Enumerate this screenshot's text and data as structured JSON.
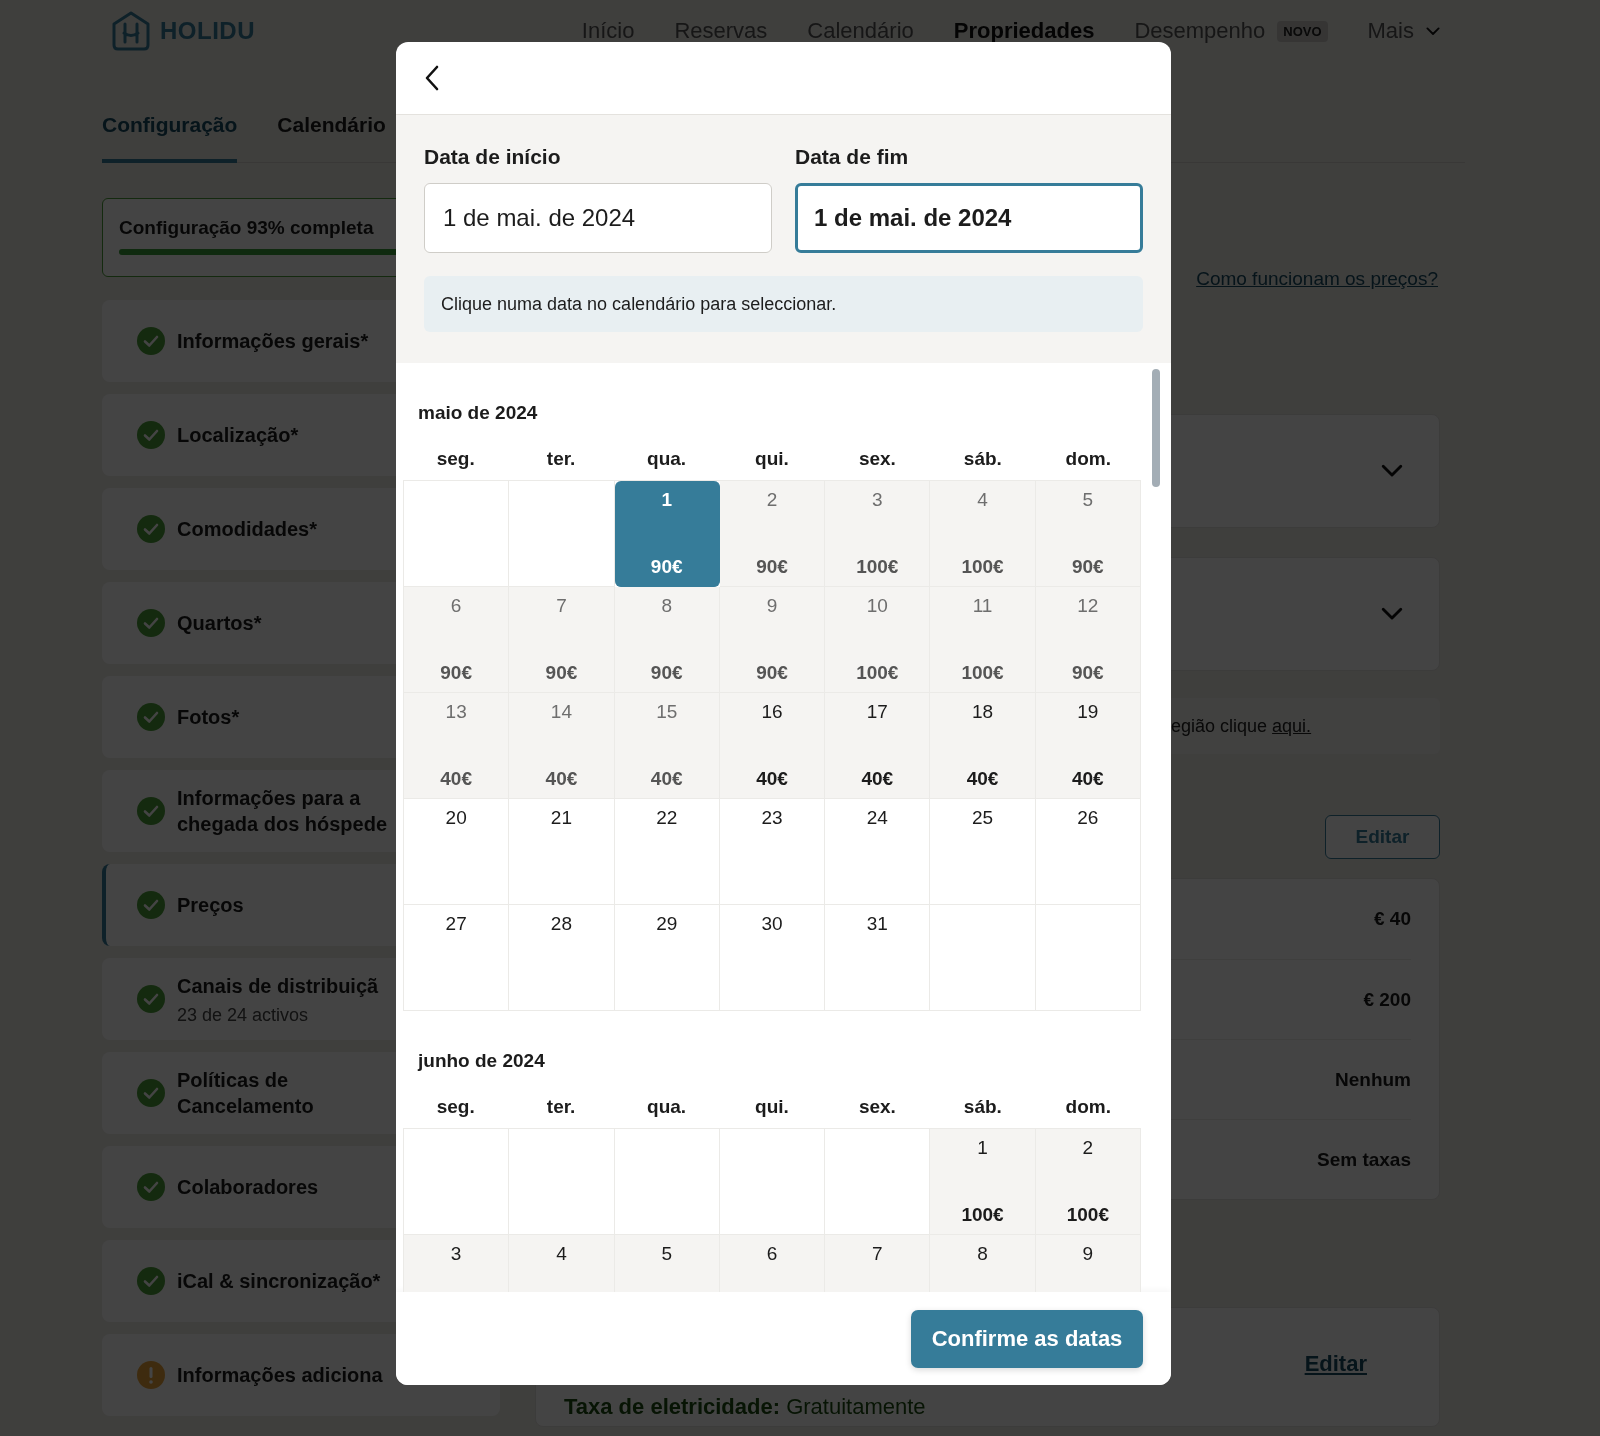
{
  "header": {
    "brand": "HOLIDU",
    "nav": [
      {
        "label": "Início",
        "selected": false
      },
      {
        "label": "Reservas",
        "selected": false
      },
      {
        "label": "Calendário",
        "selected": false
      },
      {
        "label": "Propriedades",
        "selected": true
      },
      {
        "label": "Desempenho",
        "selected": false,
        "badge": "NOVO"
      },
      {
        "label": "Mais",
        "selected": false,
        "dropdown": true
      }
    ]
  },
  "tabs": [
    {
      "label": "Configuração",
      "selected": true
    },
    {
      "label": "Calendário",
      "selected": false
    }
  ],
  "sidebar": {
    "progress": {
      "label": "Configuração 93% completa",
      "level": 0.93
    },
    "items": [
      {
        "title": "Informações gerais*",
        "complete": true,
        "selected": false
      },
      {
        "title": "Localização*",
        "complete": true,
        "selected": false
      },
      {
        "title": "Comodidades*",
        "complete": true,
        "selected": false
      },
      {
        "title": "Quartos*",
        "complete": true,
        "selected": false
      },
      {
        "title": "Fotos*",
        "complete": true,
        "selected": false
      },
      {
        "title": "Informações para a\nchegada dos hóspede",
        "complete": true,
        "selected": false
      },
      {
        "title": "Preços",
        "complete": true,
        "selected": true
      },
      {
        "title": "Canais de distribuiçã",
        "subtitle": "23 de 24 activos",
        "complete": true,
        "selected": false
      },
      {
        "title": "Políticas de\nCancelamento",
        "complete": true,
        "selected": false
      },
      {
        "title": "Colaboradores",
        "complete": true,
        "selected": false
      },
      {
        "title": "iCal & sincronização*",
        "complete": true,
        "selected": false
      },
      {
        "title": "Informações adiciona",
        "complete": false,
        "selected": false
      }
    ]
  },
  "main": {
    "help_link": "Como funcionam os preços?",
    "accordions": [
      {
        "expanded": false
      },
      {
        "expanded": false
      }
    ],
    "notice": {
      "text": "egião clique ",
      "link": "aqui."
    },
    "edit_button": "Editar",
    "price_rows": [
      {
        "value": "€ 40"
      },
      {
        "value": "€ 200"
      },
      {
        "value": "Nenhum"
      },
      {
        "value": "Sem taxas"
      }
    ],
    "fees_card": {
      "text": "**Taxa de eletricidade:** Gratuitamente",
      "edit_link": "Editar"
    }
  },
  "modal": {
    "start": {
      "label": "Data de início",
      "value": "1 de mai. de 2024",
      "focused": false
    },
    "end": {
      "label": "Data de fim",
      "value": "1 de mai. de 2024",
      "focused": true
    },
    "hint": "Clique numa data no calendário para seleccionar.",
    "months": [
      {
        "title": "maio de 2024",
        "weekdays": [
          "seg.",
          "ter.",
          "qua.",
          "qui.",
          "sex.",
          "sáb.",
          "dom."
        ],
        "weeks": [
          [
            {
              "kind": "empty"
            },
            {
              "kind": "empty"
            },
            {
              "kind": "day",
              "day": "1",
              "price": "90€",
              "selected": true,
              "available": true,
              "past": false
            },
            {
              "kind": "day",
              "day": "2",
              "price": "90€",
              "selected": false,
              "available": true,
              "past": true
            },
            {
              "kind": "day",
              "day": "3",
              "price": "100€",
              "selected": false,
              "available": true,
              "past": true
            },
            {
              "kind": "day",
              "day": "4",
              "price": "100€",
              "selected": false,
              "available": true,
              "past": true
            },
            {
              "kind": "day",
              "day": "5",
              "price": "90€",
              "selected": false,
              "available": true,
              "past": true
            }
          ],
          [
            {
              "kind": "day",
              "day": "6",
              "price": "90€",
              "selected": false,
              "available": true,
              "past": true
            },
            {
              "kind": "day",
              "day": "7",
              "price": "90€",
              "selected": false,
              "available": true,
              "past": true
            },
            {
              "kind": "day",
              "day": "8",
              "price": "90€",
              "selected": false,
              "available": true,
              "past": true
            },
            {
              "kind": "day",
              "day": "9",
              "price": "90€",
              "selected": false,
              "available": true,
              "past": true
            },
            {
              "kind": "day",
              "day": "10",
              "price": "100€",
              "selected": false,
              "available": true,
              "past": true
            },
            {
              "kind": "day",
              "day": "11",
              "price": "100€",
              "selected": false,
              "available": true,
              "past": true
            },
            {
              "kind": "day",
              "day": "12",
              "price": "90€",
              "selected": false,
              "available": true,
              "past": true
            }
          ],
          [
            {
              "kind": "day",
              "day": "13",
              "price": "40€",
              "selected": false,
              "available": true,
              "past": true
            },
            {
              "kind": "day",
              "day": "14",
              "price": "40€",
              "selected": false,
              "available": true,
              "past": true
            },
            {
              "kind": "day",
              "day": "15",
              "price": "40€",
              "selected": false,
              "available": true,
              "past": true
            },
            {
              "kind": "day",
              "day": "16",
              "price": "40€",
              "selected": false,
              "available": true,
              "past": false
            },
            {
              "kind": "day",
              "day": "17",
              "price": "40€",
              "selected": false,
              "available": true,
              "past": false
            },
            {
              "kind": "day",
              "day": "18",
              "price": "40€",
              "selected": false,
              "available": true,
              "past": false
            },
            {
              "kind": "day",
              "day": "19",
              "price": "40€",
              "selected": false,
              "available": true,
              "past": false
            }
          ],
          [
            {
              "kind": "day",
              "day": "20",
              "selected": false,
              "available": false,
              "past": false
            },
            {
              "kind": "day",
              "day": "21",
              "selected": false,
              "available": false,
              "past": false
            },
            {
              "kind": "day",
              "day": "22",
              "selected": false,
              "available": false,
              "past": false
            },
            {
              "kind": "day",
              "day": "23",
              "selected": false,
              "available": false,
              "past": false
            },
            {
              "kind": "day",
              "day": "24",
              "selected": false,
              "available": false,
              "past": false
            },
            {
              "kind": "day",
              "day": "25",
              "selected": false,
              "available": false,
              "past": false
            },
            {
              "kind": "day",
              "day": "26",
              "selected": false,
              "available": false,
              "past": false
            }
          ],
          [
            {
              "kind": "day",
              "day": "27",
              "selected": false,
              "available": false,
              "past": false
            },
            {
              "kind": "day",
              "day": "28",
              "selected": false,
              "available": false,
              "past": false
            },
            {
              "kind": "day",
              "day": "29",
              "selected": false,
              "available": false,
              "past": false
            },
            {
              "kind": "day",
              "day": "30",
              "selected": false,
              "available": false,
              "past": false
            },
            {
              "kind": "day",
              "day": "31",
              "selected": false,
              "available": false,
              "past": false
            },
            {
              "kind": "empty"
            },
            {
              "kind": "empty"
            }
          ]
        ]
      },
      {
        "title": "junho de 2024",
        "weekdays": [
          "seg.",
          "ter.",
          "qua.",
          "qui.",
          "sex.",
          "sáb.",
          "dom."
        ],
        "weeks": [
          [
            {
              "kind": "empty"
            },
            {
              "kind": "empty"
            },
            {
              "kind": "empty"
            },
            {
              "kind": "empty"
            },
            {
              "kind": "empty"
            },
            {
              "kind": "day",
              "day": "1",
              "price": "100€",
              "selected": false,
              "available": true,
              "past": false
            },
            {
              "kind": "day",
              "day": "2",
              "price": "100€",
              "selected": false,
              "available": true,
              "past": false
            }
          ],
          [
            {
              "kind": "day",
              "day": "3",
              "selected": false,
              "available": true,
              "past": false
            },
            {
              "kind": "day",
              "day": "4",
              "selected": false,
              "available": true,
              "past": false
            },
            {
              "kind": "day",
              "day": "5",
              "selected": false,
              "available": true,
              "past": false
            },
            {
              "kind": "day",
              "day": "6",
              "selected": false,
              "available": true,
              "past": false
            },
            {
              "kind": "day",
              "day": "7",
              "selected": false,
              "available": true,
              "past": false
            },
            {
              "kind": "day",
              "day": "8",
              "selected": false,
              "available": true,
              "past": false
            },
            {
              "kind": "day",
              "day": "9",
              "selected": false,
              "available": true,
              "past": false
            }
          ]
        ]
      }
    ],
    "confirm": "Confirme as datas"
  }
}
